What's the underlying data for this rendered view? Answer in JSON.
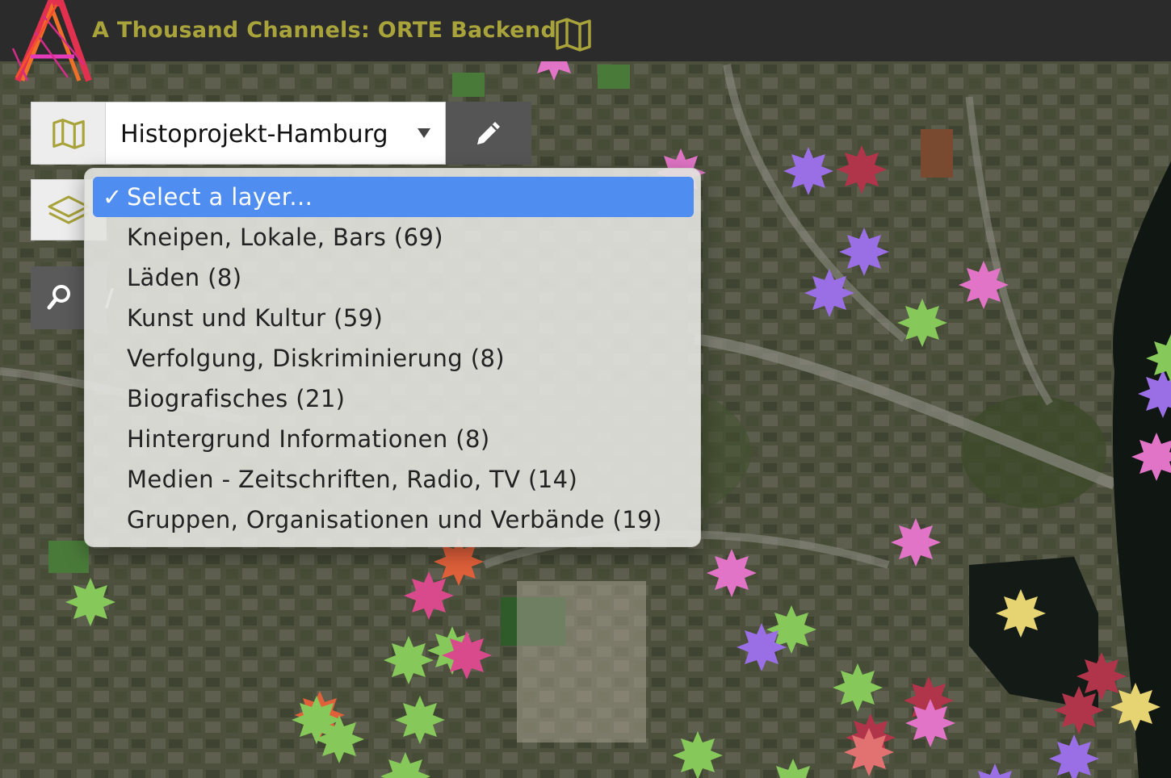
{
  "header": {
    "title": "A Thousand Channels: ORTE Backend",
    "title_icon": "map-icon",
    "logo": "A",
    "title_color": "#a8a33a"
  },
  "toolbar": {
    "map_button_icon": "map-icon",
    "selected_map": "Histoprojekt-Hamburg",
    "edit_button_icon": "pencil-icon",
    "layers_button_icon": "layers-icon",
    "search_button_icon": "search-icon"
  },
  "layer_dropdown": {
    "selected_index": 0,
    "selected_color": "#4f8df0",
    "options": [
      "Select a layer...",
      "Kneipen, Lokale, Bars (69)",
      "Läden (8)",
      "Kunst und Kultur (59)",
      "Verfolgung, Diskriminierung (8)",
      "Biografisches (21)",
      "Hintergrund Informationen (8)",
      "Medien - Zeitschriften, Radio, TV (14)",
      "Gruppen, Organisationen und Verbände (19)"
    ]
  },
  "marker_colors": {
    "purple": "#9a6fe6",
    "pink": "#e174c6",
    "green": "#86c95a",
    "red": "#b0344a",
    "orange": "#e0603a",
    "yellow": "#e6d371",
    "magenta": "#d94a8c"
  }
}
